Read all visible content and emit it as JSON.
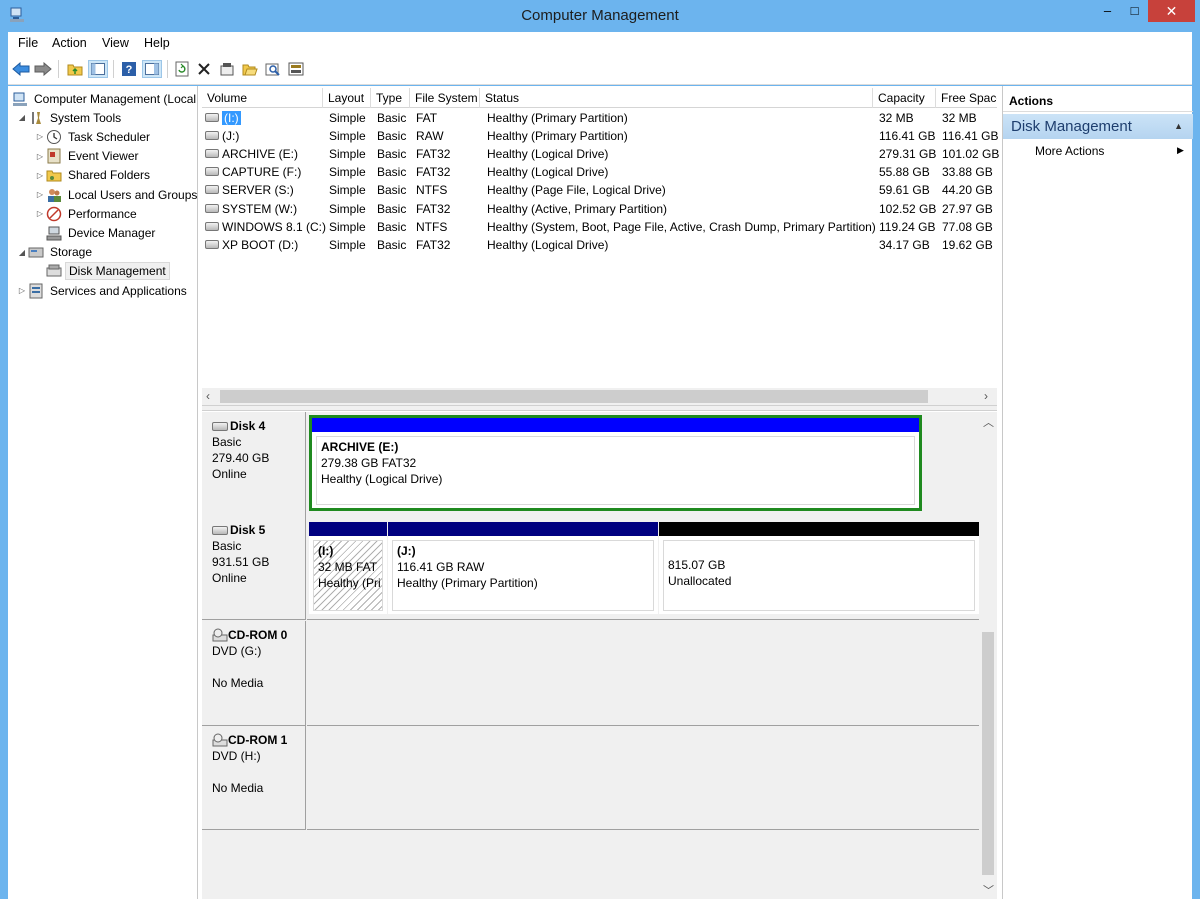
{
  "window": {
    "title": "Computer Management",
    "min_glyph": "‒",
    "max_glyph": "□",
    "close_glyph": "✕"
  },
  "menu": [
    "File",
    "Action",
    "View",
    "Help"
  ],
  "tree": {
    "items": [
      {
        "label": "Computer Management (Local",
        "level": 0,
        "arrow": "",
        "icon": "computer-management-icon"
      },
      {
        "label": "System Tools",
        "level": 1,
        "arrow": "◢",
        "icon": "system-tools-icon"
      },
      {
        "label": "Task Scheduler",
        "level": 2,
        "arrow": "▷",
        "icon": "task-scheduler-icon"
      },
      {
        "label": "Event Viewer",
        "level": 2,
        "arrow": "▷",
        "icon": "event-viewer-icon"
      },
      {
        "label": "Shared Folders",
        "level": 2,
        "arrow": "▷",
        "icon": "shared-folders-icon"
      },
      {
        "label": "Local Users and Groups",
        "level": 2,
        "arrow": "▷",
        "icon": "local-users-icon"
      },
      {
        "label": "Performance",
        "level": 2,
        "arrow": "▷",
        "icon": "performance-icon"
      },
      {
        "label": "Device Manager",
        "level": 2,
        "arrow": "",
        "icon": "device-manager-icon"
      },
      {
        "label": "Storage",
        "level": 1,
        "arrow": "◢",
        "icon": "storage-icon"
      },
      {
        "label": "Disk Management",
        "level": 2,
        "arrow": "",
        "icon": "disk-management-icon",
        "selected": true
      },
      {
        "label": "Services and Applications",
        "level": 1,
        "arrow": "▷",
        "icon": "services-apps-icon"
      }
    ]
  },
  "volumes": {
    "columns": [
      "Volume",
      "Layout",
      "Type",
      "File System",
      "Status",
      "Capacity",
      "Free Space"
    ],
    "rows": [
      {
        "volume": "(I:)",
        "layout": "Simple",
        "type": "Basic",
        "fs": "FAT",
        "status": "Healthy (Primary Partition)",
        "capacity": "32 MB",
        "free": "32 MB",
        "selected": true
      },
      {
        "volume": "(J:)",
        "layout": "Simple",
        "type": "Basic",
        "fs": "RAW",
        "status": "Healthy (Primary Partition)",
        "capacity": "116.41 GB",
        "free": "116.41 GB"
      },
      {
        "volume": "ARCHIVE (E:)",
        "layout": "Simple",
        "type": "Basic",
        "fs": "FAT32",
        "status": "Healthy (Logical Drive)",
        "capacity": "279.31 GB",
        "free": "101.02 GB"
      },
      {
        "volume": "CAPTURE (F:)",
        "layout": "Simple",
        "type": "Basic",
        "fs": "FAT32",
        "status": "Healthy (Logical Drive)",
        "capacity": "55.88 GB",
        "free": "33.88 GB"
      },
      {
        "volume": "SERVER (S:)",
        "layout": "Simple",
        "type": "Basic",
        "fs": "NTFS",
        "status": "Healthy (Page File, Logical Drive)",
        "capacity": "59.61 GB",
        "free": "44.20 GB"
      },
      {
        "volume": "SYSTEM (W:)",
        "layout": "Simple",
        "type": "Basic",
        "fs": "FAT32",
        "status": "Healthy (Active, Primary Partition)",
        "capacity": "102.52 GB",
        "free": "27.97 GB"
      },
      {
        "volume": "WINDOWS 8.1 (C:)",
        "layout": "Simple",
        "type": "Basic",
        "fs": "NTFS",
        "status": "Healthy (System, Boot, Page File, Active, Crash Dump, Primary Partition)",
        "capacity": "119.24 GB",
        "free": "77.08 GB"
      },
      {
        "volume": "XP BOOT (D:)",
        "layout": "Simple",
        "type": "Basic",
        "fs": "FAT32",
        "status": "Healthy (Logical Drive)",
        "capacity": "34.17 GB",
        "free": "19.62 GB"
      }
    ]
  },
  "disks": [
    {
      "name": "Disk 4",
      "kind": "Basic",
      "size": "279.40 GB",
      "state": "Online",
      "blank": "",
      "partitions": [
        {
          "title": "ARCHIVE  (E:)",
          "line2": "279.38 GB FAT32",
          "line3": "Healthy (Logical Drive)",
          "style": "logical"
        }
      ]
    },
    {
      "name": "Disk 5",
      "kind": "Basic",
      "size": "931.51 GB",
      "state": "Online",
      "blank": "",
      "partitions": [
        {
          "title": "(I:)",
          "line2": "32 MB FAT",
          "line3": "Healthy (Pri",
          "style": "primary"
        },
        {
          "title": "(J:)",
          "line2": "116.41 GB RAW",
          "line3": "Healthy (Primary Partition)",
          "style": "primary"
        },
        {
          "title": "",
          "line2": "815.07 GB",
          "line3": "Unallocated",
          "style": "unalloc"
        }
      ]
    },
    {
      "name": "CD-ROM 0",
      "kind": "DVD (G:)",
      "size": "",
      "state": "No Media",
      "partitions": []
    },
    {
      "name": "CD-ROM 1",
      "kind": "DVD (H:)",
      "size": "",
      "state": "No Media",
      "partitions": []
    }
  ],
  "actions": {
    "header": "Actions",
    "section": "Disk Management",
    "item": "More Actions"
  },
  "colors": {
    "primary_partition": "#000080",
    "logical_drive": "#0000ff",
    "unallocated": "#000000",
    "selection": "#3399ff",
    "title_bar": "#6cb4ee"
  }
}
